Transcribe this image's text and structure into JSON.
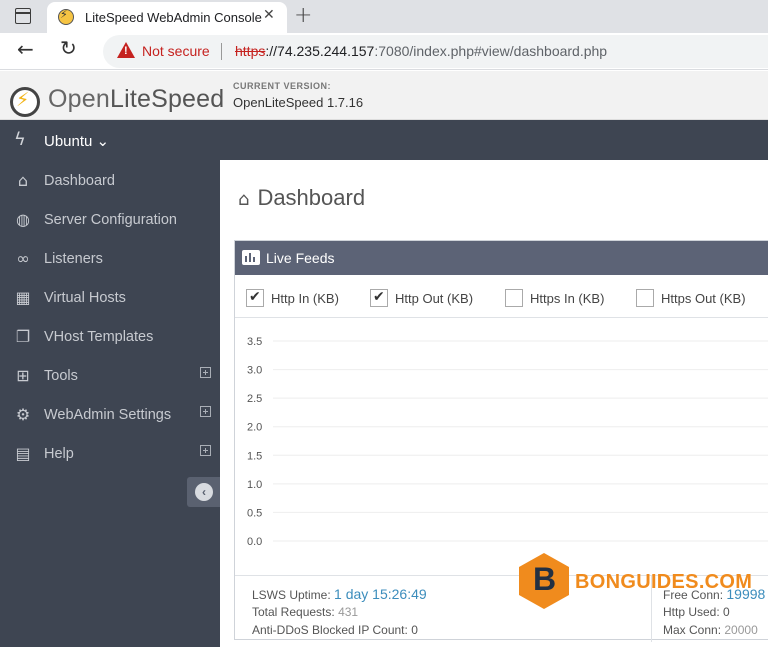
{
  "browser": {
    "tab_title": "LiteSpeed WebAdmin Console",
    "close_glyph": "✕",
    "newtab_glyph": "+",
    "security_label": "Not secure",
    "url_scheme": "https",
    "url_rest_host": "://74.235.244.157",
    "url_rest_path": ":7080/index.php#view/dashboard.php"
  },
  "header": {
    "logo_open": "Open",
    "logo_rest": "LiteSpeed",
    "version_label": "CURRENT VERSION:",
    "version_value": "OpenLiteSpeed 1.7.16",
    "server_name": "Ubuntu ⌄"
  },
  "sidebar": {
    "items": [
      {
        "label": "Dashboard",
        "icon": "home-icon",
        "glyph": "⌂",
        "expandable": false
      },
      {
        "label": "Server Configuration",
        "icon": "globe-icon",
        "glyph": "◍",
        "expandable": false
      },
      {
        "label": "Listeners",
        "icon": "link-icon",
        "glyph": "∞",
        "expandable": false
      },
      {
        "label": "Virtual Hosts",
        "icon": "cubes-icon",
        "glyph": "▦",
        "expandable": false
      },
      {
        "label": "VHost Templates",
        "icon": "copy-icon",
        "glyph": "❐",
        "expandable": false
      },
      {
        "label": "Tools",
        "icon": "grid-icon",
        "glyph": "⊞",
        "expandable": true
      },
      {
        "label": "WebAdmin Settings",
        "icon": "gear-icon",
        "glyph": "⚙",
        "expandable": true
      },
      {
        "label": "Help",
        "icon": "book-icon",
        "glyph": "▤",
        "expandable": true
      }
    ],
    "collapse_glyph": "‹"
  },
  "main": {
    "page_title": "Dashboard",
    "widget": {
      "title": "Live Feeds",
      "checkboxes": [
        {
          "label": "Http In (KB)",
          "checked": true
        },
        {
          "label": "Http Out (KB)",
          "checked": true
        },
        {
          "label": "Https In (KB)",
          "checked": false
        },
        {
          "label": "Https Out (KB)",
          "checked": false
        }
      ]
    },
    "stats": {
      "uptime_label": "LSWS Uptime:",
      "uptime_value": "1 day 15:26:49",
      "requests_label": "Total Requests:",
      "requests_value": "431",
      "ddos_label": "Anti-DDoS Blocked IP Count:",
      "ddos_value": "0",
      "free_conn_label": "Free Conn:",
      "free_conn_value": "19998",
      "http_used_label": "Http Used:",
      "http_used_value": "0",
      "max_conn_label": "Max Conn:",
      "max_conn_value": "20000"
    }
  },
  "chart_data": {
    "type": "line",
    "title": "",
    "xlabel": "",
    "ylabel": "",
    "yticks": [
      "3.5",
      "3.0",
      "2.5",
      "2.0",
      "1.5",
      "1.0",
      "0.5",
      "0.0"
    ],
    "ylim": [
      0,
      3.5
    ],
    "grid": true,
    "series": []
  },
  "watermark": {
    "letter": "B",
    "text": "BONGUIDES.COM"
  },
  "colors": {
    "sidebar_bg": "#3e4552",
    "widget_head": "#5c6376",
    "accent_blue": "#3c8dbc",
    "brand_orange": "#f08b1d"
  }
}
